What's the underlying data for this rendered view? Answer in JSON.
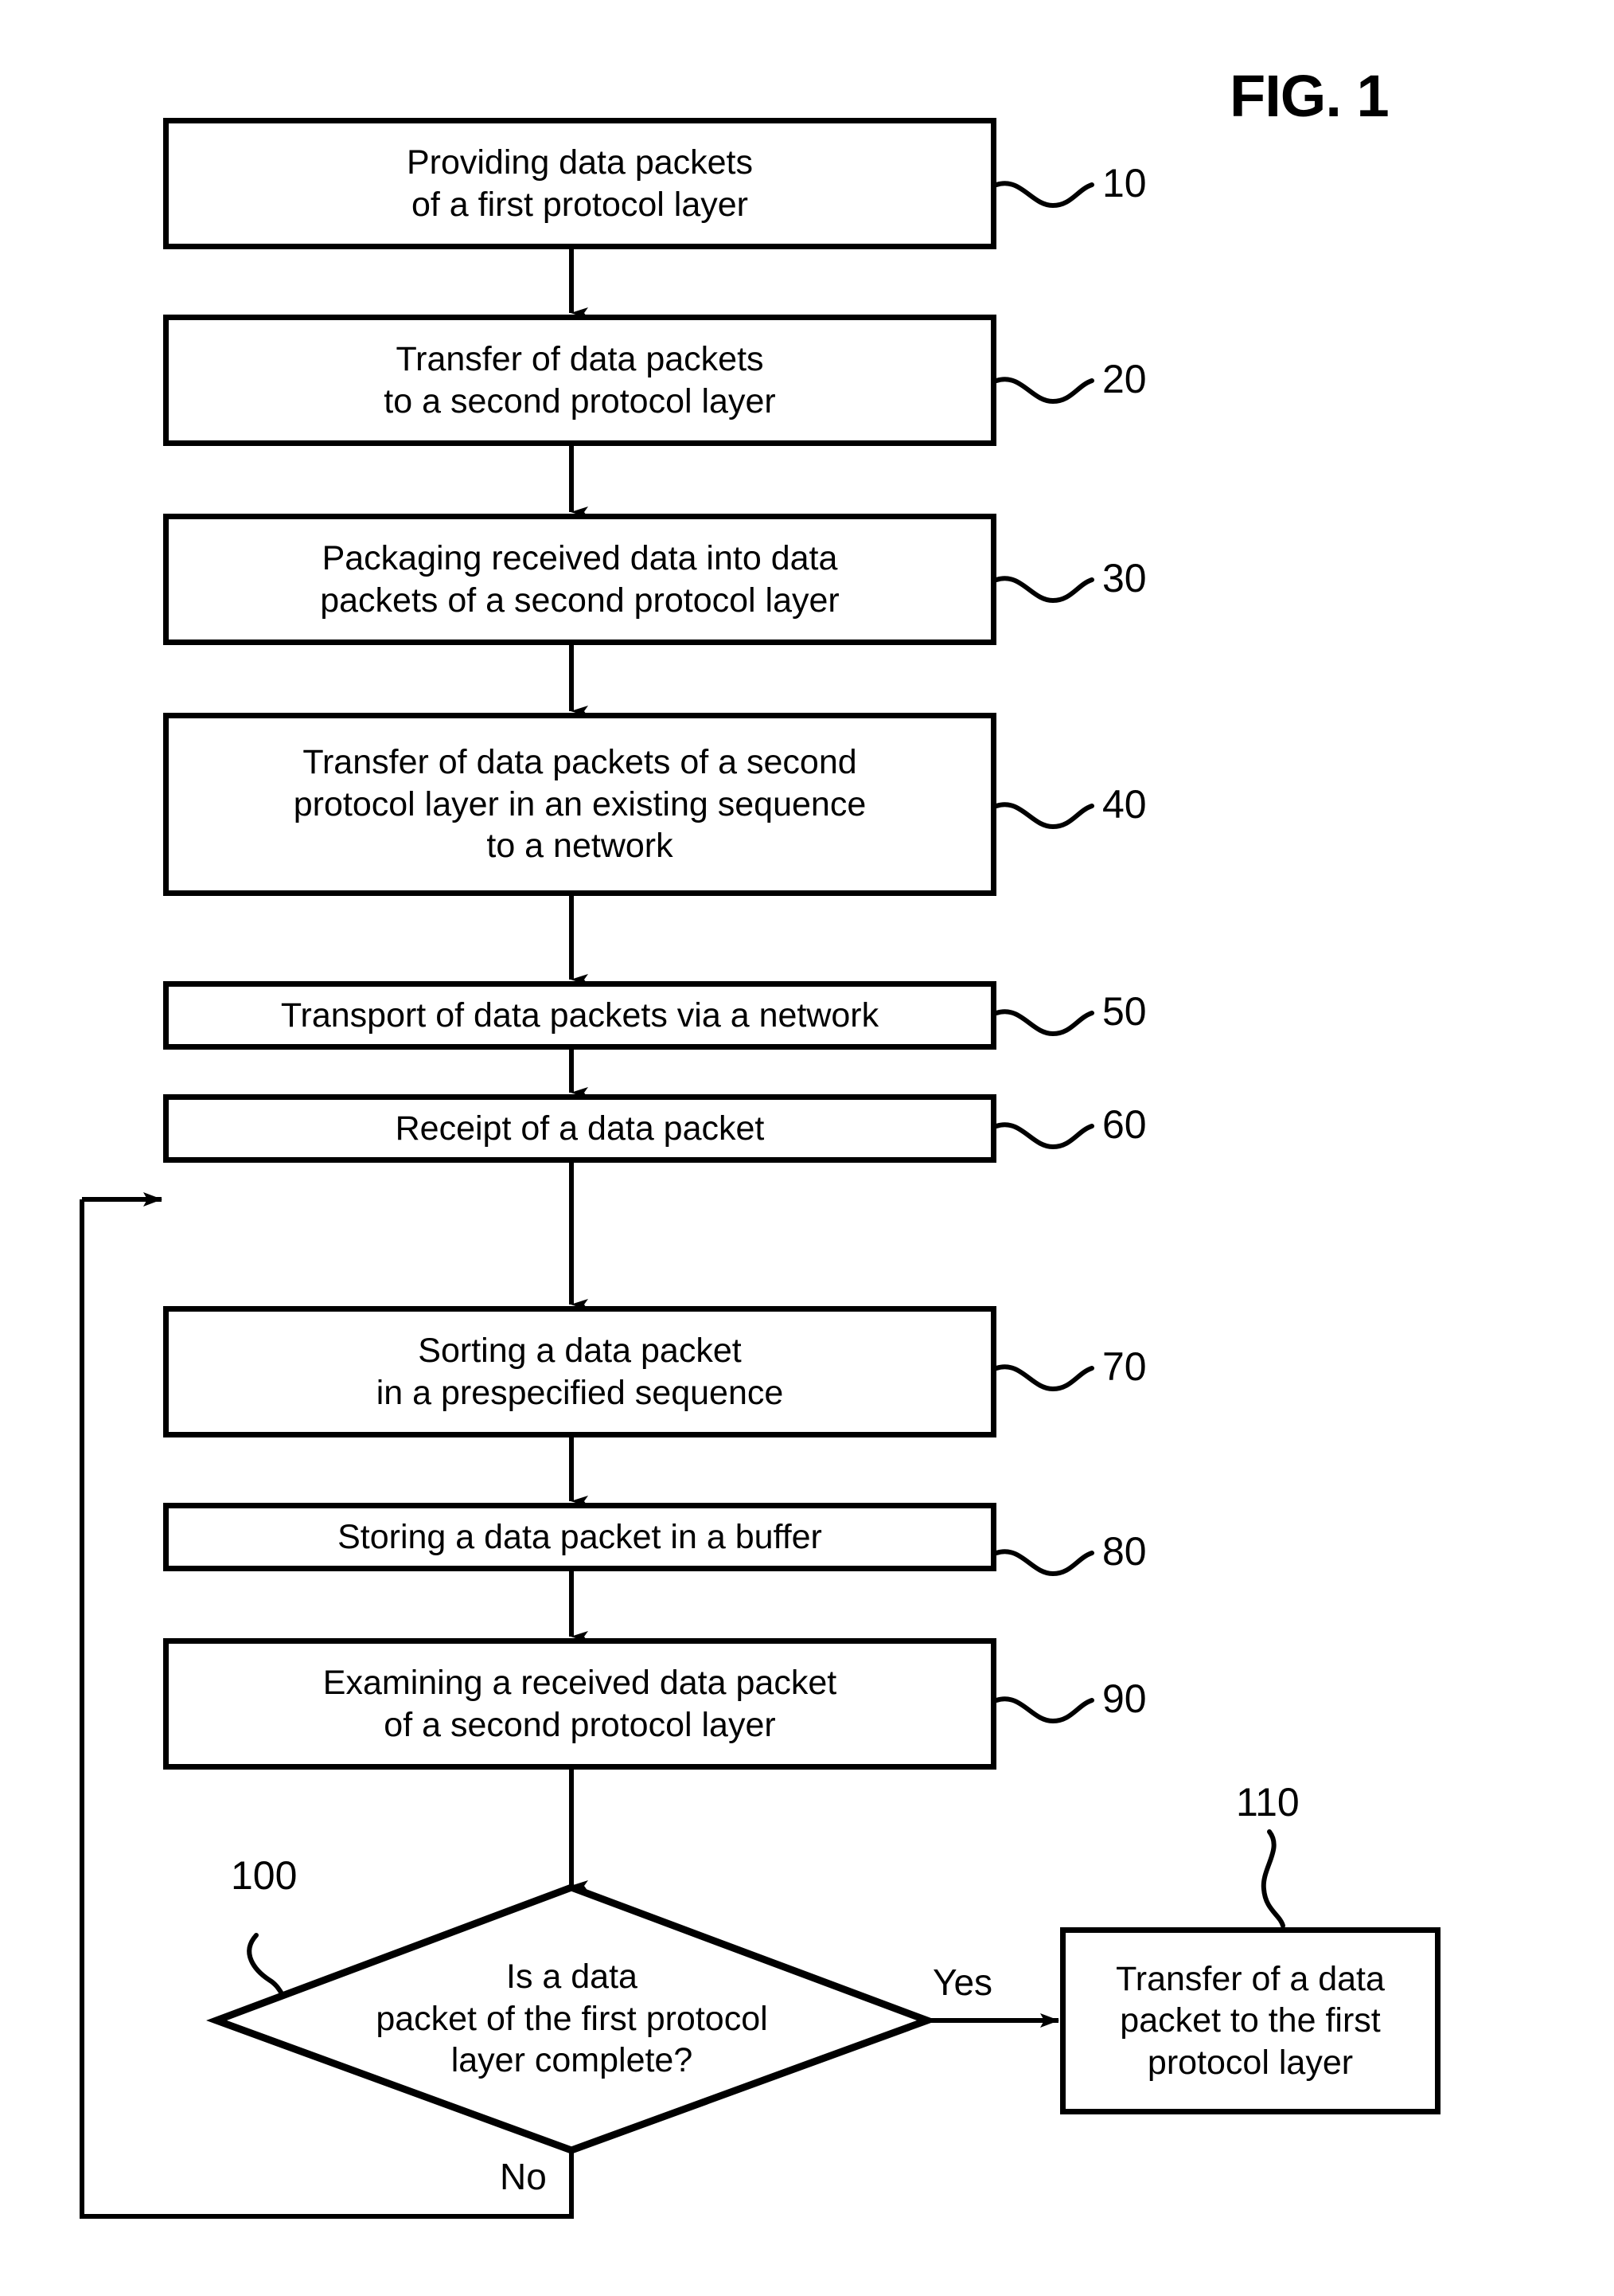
{
  "figure": {
    "title": "FIG. 1",
    "type": "process-flowchart"
  },
  "nodes": [
    {
      "id": "n10",
      "ref": "10",
      "shape": "process",
      "text": "Providing data packets\nof a first protocol layer"
    },
    {
      "id": "n20",
      "ref": "20",
      "shape": "process",
      "text": "Transfer of data packets\nto a second protocol layer"
    },
    {
      "id": "n30",
      "ref": "30",
      "shape": "process",
      "text": "Packaging received data into data\npackets of a second protocol layer"
    },
    {
      "id": "n40",
      "ref": "40",
      "shape": "process",
      "text": "Transfer of data packets of a second\nprotocol layer in an existing sequence\nto a network"
    },
    {
      "id": "n50",
      "ref": "50",
      "shape": "process",
      "text": "Transport of data packets via a network"
    },
    {
      "id": "n60",
      "ref": "60",
      "shape": "process",
      "text": "Receipt of a data packet"
    },
    {
      "id": "n70",
      "ref": "70",
      "shape": "process",
      "text": "Sorting a data packet\nin a prespecified sequence"
    },
    {
      "id": "n80",
      "ref": "80",
      "shape": "process",
      "text": "Storing a data packet in a buffer"
    },
    {
      "id": "n90",
      "ref": "90",
      "shape": "process",
      "text": "Examining a received data packet\nof a second protocol layer"
    },
    {
      "id": "n100",
      "ref": "100",
      "shape": "decision",
      "text": "Is a data\npacket of the first protocol\nlayer complete?"
    },
    {
      "id": "n110",
      "ref": "110",
      "shape": "process",
      "text": "Transfer of a data\npacket to the first\nprotocol layer"
    }
  ],
  "edge_labels": {
    "yes": "Yes",
    "no": "No"
  },
  "colors": {
    "stroke": "#000000",
    "fill": "#ffffff",
    "text": "#000000"
  }
}
